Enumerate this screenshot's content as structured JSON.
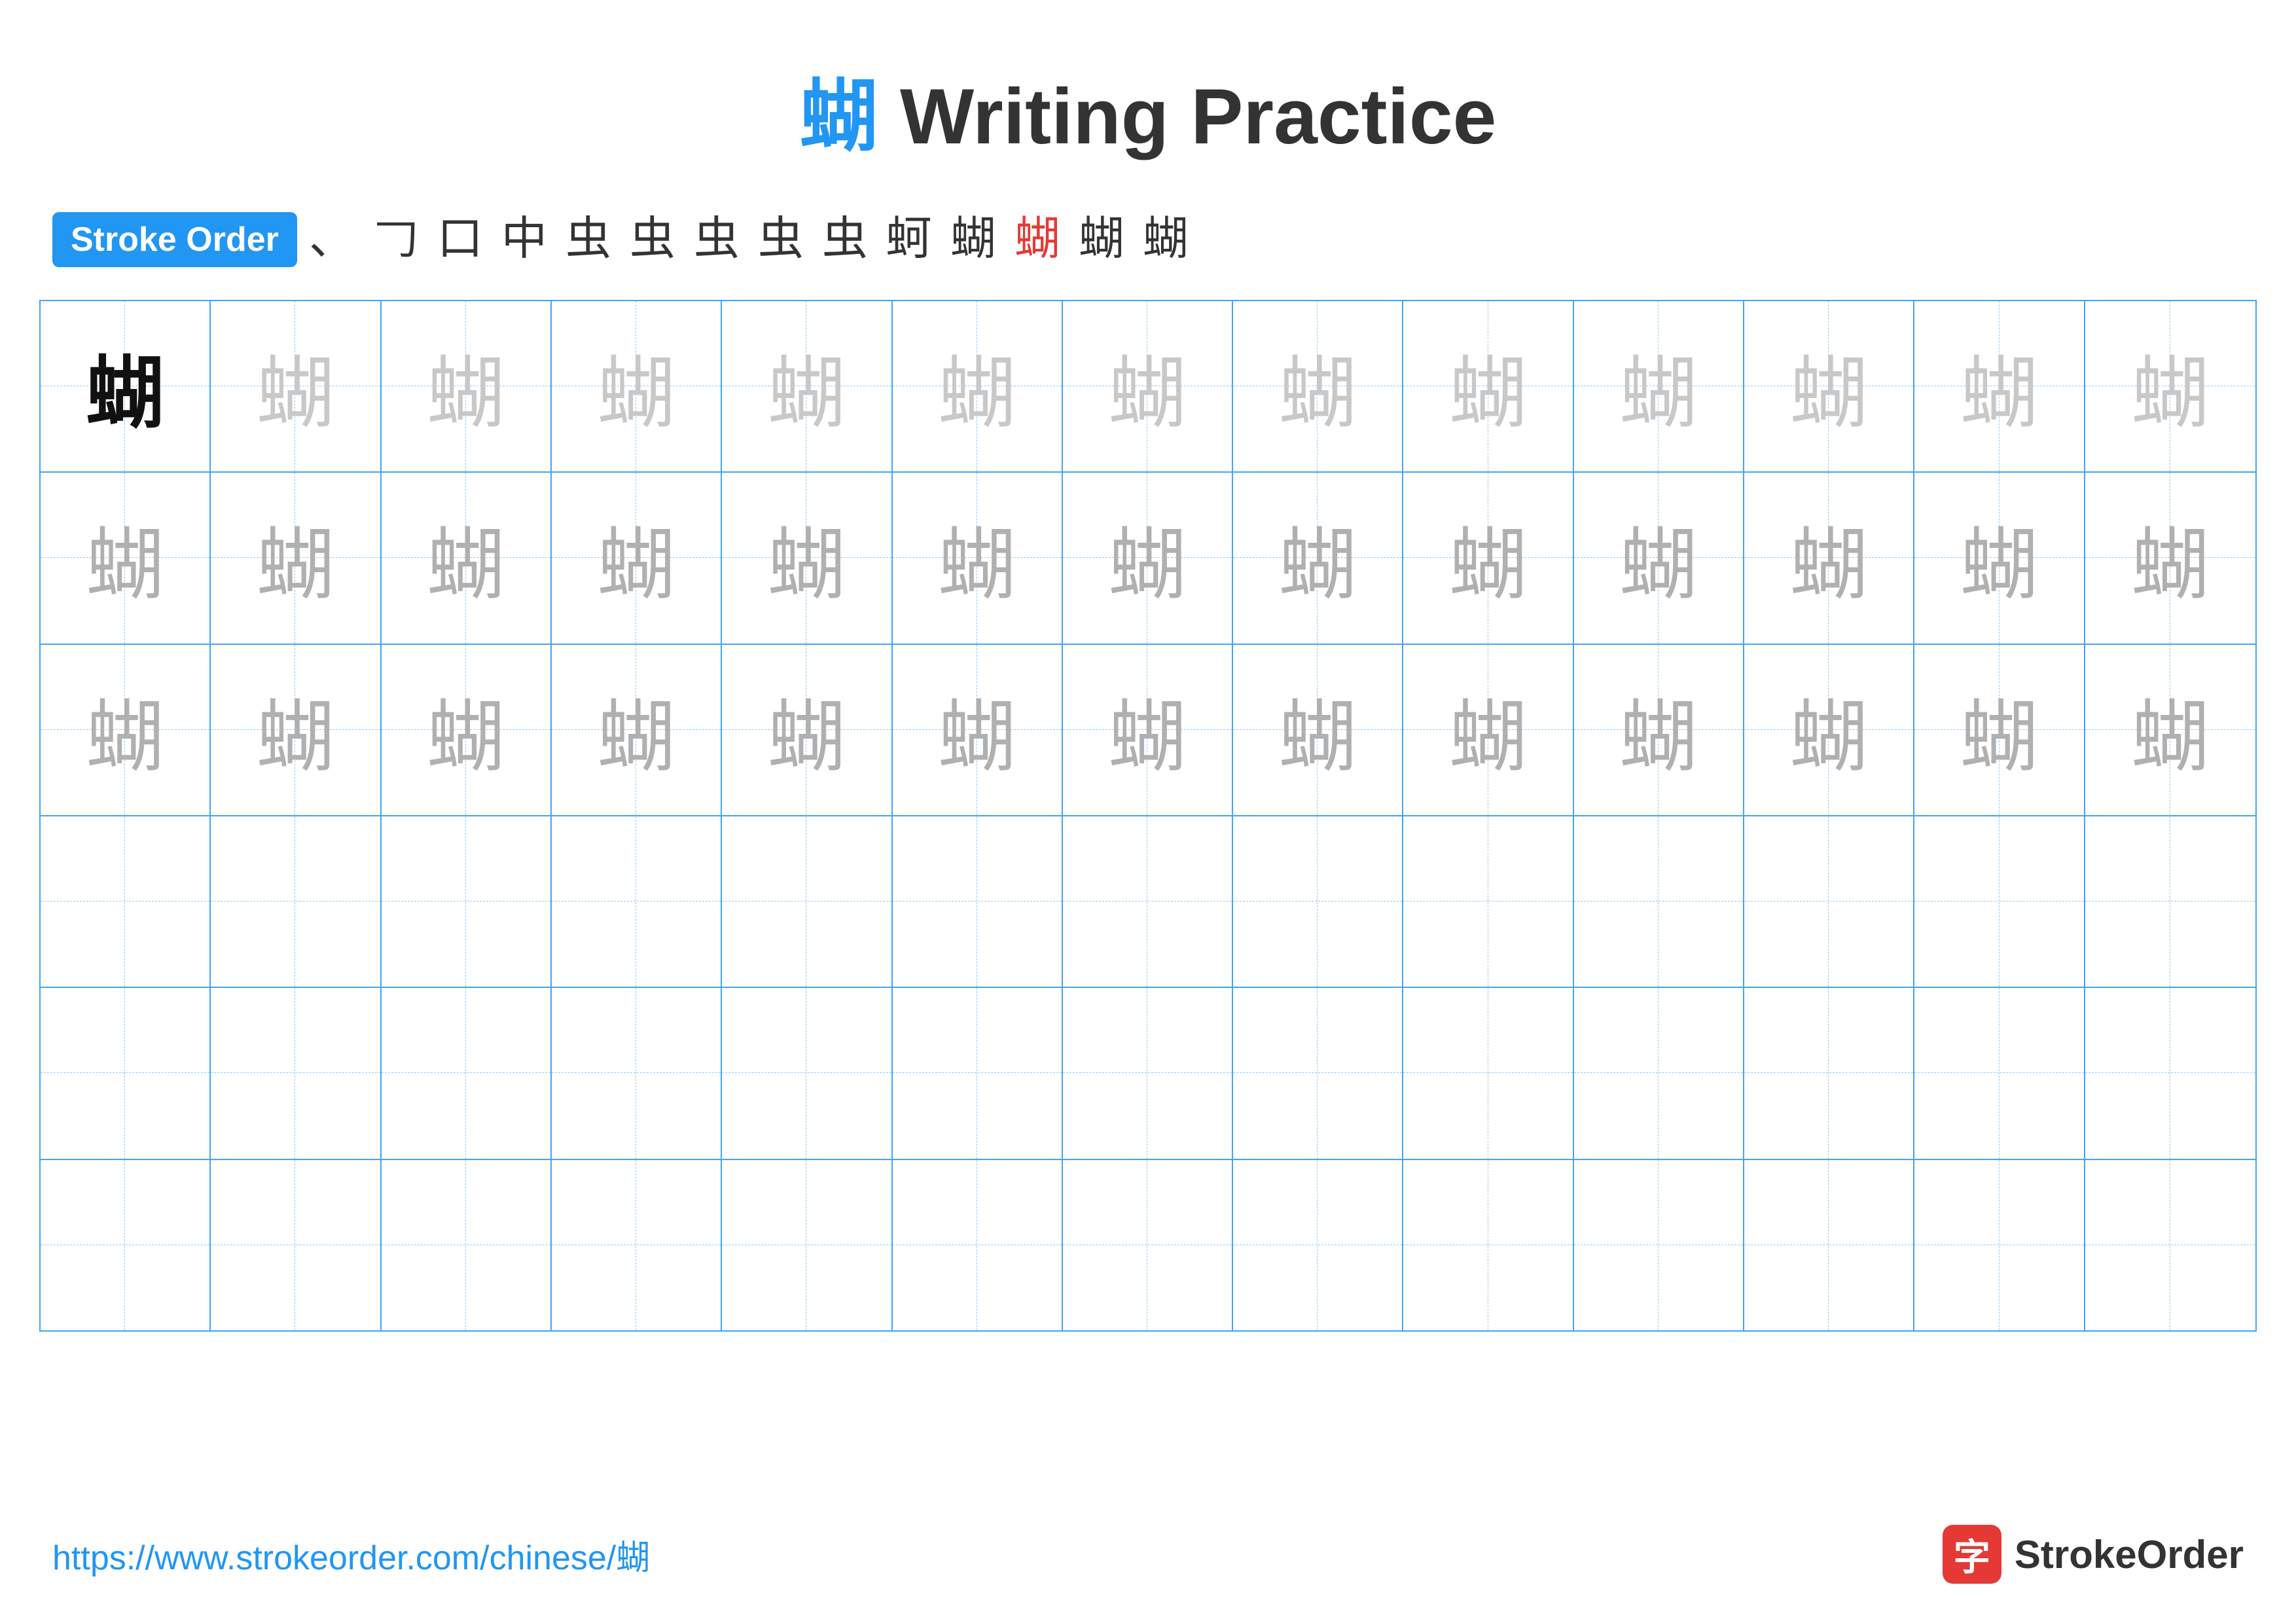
{
  "title": {
    "chinese": "蝴",
    "rest": " Writing Practice"
  },
  "stroke_order": {
    "badge_label": "Stroke Order",
    "strokes": [
      "、",
      "𠃌",
      "口",
      "中",
      "虫",
      "虫",
      "虫",
      "虫+",
      "虫𠃌",
      "虹",
      "蚵",
      "蝴-",
      "蝴|",
      "蝴",
      "蝴"
    ]
  },
  "grid": {
    "rows": 6,
    "cols": 13,
    "char": "蝴",
    "row1": [
      "dark",
      "light",
      "light",
      "light",
      "light",
      "light",
      "light",
      "light",
      "light",
      "light",
      "light",
      "light",
      "light"
    ],
    "row2": [
      "medium",
      "medium",
      "medium",
      "medium",
      "medium",
      "medium",
      "medium",
      "medium",
      "medium",
      "medium",
      "medium",
      "medium",
      "medium"
    ],
    "row3": [
      "medium",
      "medium",
      "medium",
      "medium",
      "medium",
      "medium",
      "medium",
      "medium",
      "medium",
      "medium",
      "medium",
      "medium",
      "medium"
    ],
    "row4": "empty",
    "row5": "empty",
    "row6": "empty"
  },
  "footer": {
    "url": "https://www.strokeorder.com/chinese/蝴",
    "logo_char": "字",
    "logo_text": "StrokeOrder"
  }
}
